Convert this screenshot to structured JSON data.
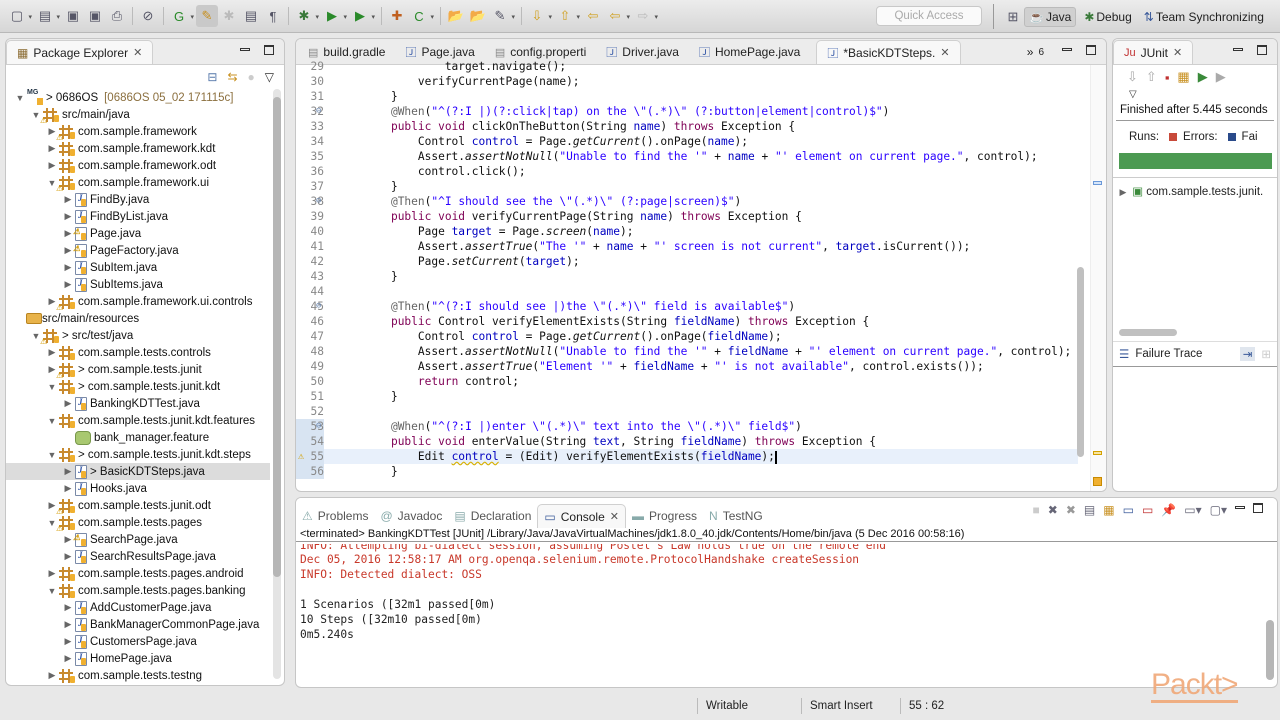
{
  "toolbar": {
    "quick_access_placeholder": "Quick Access",
    "icons": [
      "new-icon",
      "new-menu-icon",
      "save-icon",
      "save-all-icon",
      "print-icon",
      "skip-breakpoints-icon",
      "new-gradle-icon",
      "brush-icon",
      "bug-disabled-icon",
      "toggle-block-icon",
      "show-whitespace-icon",
      "debug-icon",
      "run-icon",
      "run-external-icon",
      "new-package-icon",
      "new-class-icon",
      "open-type-icon",
      "open-folder-icon",
      "search-icon",
      "next-annotation-icon",
      "prev-annotation-icon",
      "last-edit-icon",
      "back-icon",
      "forward-icon"
    ],
    "perspectives": [
      {
        "label": "Java",
        "icon": "java-perspective-icon",
        "active": true
      },
      {
        "label": "Debug",
        "icon": "debug-perspective-icon",
        "active": false
      },
      {
        "label": "Team Synchronizing",
        "icon": "team-sync-icon",
        "active": false
      }
    ]
  },
  "package_explorer": {
    "title": "Package Explorer",
    "tree": [
      {
        "depth": 0,
        "twisty": "open",
        "icon": "proj",
        "label": "> 0686OS",
        "decoration": "[0686OS 05_02 171115c]"
      },
      {
        "depth": 1,
        "twisty": "open",
        "icon": "pkg warn",
        "label": "src/main/java"
      },
      {
        "depth": 2,
        "twisty": "closed",
        "icon": "pkg warn",
        "label": "com.sample.framework"
      },
      {
        "depth": 2,
        "twisty": "closed",
        "icon": "pkg",
        "label": "com.sample.framework.kdt"
      },
      {
        "depth": 2,
        "twisty": "closed",
        "icon": "pkg",
        "label": "com.sample.framework.odt"
      },
      {
        "depth": 2,
        "twisty": "open",
        "icon": "pkg warn",
        "label": "com.sample.framework.ui"
      },
      {
        "depth": 3,
        "twisty": "closed",
        "icon": "jf",
        "label": "FindBy.java"
      },
      {
        "depth": 3,
        "twisty": "closed",
        "icon": "jf",
        "label": "FindByList.java"
      },
      {
        "depth": 3,
        "twisty": "closed",
        "icon": "jf warn",
        "label": "Page.java"
      },
      {
        "depth": 3,
        "twisty": "closed",
        "icon": "jf warn",
        "label": "PageFactory.java"
      },
      {
        "depth": 3,
        "twisty": "closed",
        "icon": "jf",
        "label": "SubItem.java"
      },
      {
        "depth": 3,
        "twisty": "closed",
        "icon": "jf",
        "label": "SubItems.java"
      },
      {
        "depth": 2,
        "twisty": "closed",
        "icon": "pkg warn",
        "label": "com.sample.framework.ui.controls"
      },
      {
        "depth": 1,
        "twisty": "none",
        "icon": "fold",
        "label": "src/main/resources"
      },
      {
        "depth": 1,
        "twisty": "open",
        "icon": "pkg warn",
        "label": "> src/test/java"
      },
      {
        "depth": 2,
        "twisty": "closed",
        "icon": "pkg",
        "label": "com.sample.tests.controls"
      },
      {
        "depth": 2,
        "twisty": "closed",
        "icon": "pkg warn",
        "label": "> com.sample.tests.junit"
      },
      {
        "depth": 2,
        "twisty": "open",
        "icon": "pkg",
        "label": "> com.sample.tests.junit.kdt"
      },
      {
        "depth": 3,
        "twisty": "closed",
        "icon": "jf",
        "label": "BankingKDTTest.java"
      },
      {
        "depth": 2,
        "twisty": "open",
        "icon": "pkg",
        "label": "com.sample.tests.junit.kdt.features"
      },
      {
        "depth": 3,
        "twisty": "none",
        "icon": "feat",
        "label": "bank_manager.feature"
      },
      {
        "depth": 2,
        "twisty": "open",
        "icon": "pkg",
        "label": "> com.sample.tests.junit.kdt.steps"
      },
      {
        "depth": 3,
        "twisty": "closed",
        "icon": "jf",
        "label": "> BasicKDTSteps.java",
        "selected": true
      },
      {
        "depth": 3,
        "twisty": "closed",
        "icon": "jf",
        "label": "Hooks.java"
      },
      {
        "depth": 2,
        "twisty": "closed",
        "icon": "pkg warn",
        "label": "com.sample.tests.junit.odt"
      },
      {
        "depth": 2,
        "twisty": "open",
        "icon": "pkg warn",
        "label": "com.sample.tests.pages"
      },
      {
        "depth": 3,
        "twisty": "closed",
        "icon": "jf warn",
        "label": "SearchPage.java"
      },
      {
        "depth": 3,
        "twisty": "closed",
        "icon": "jf",
        "label": "SearchResultsPage.java"
      },
      {
        "depth": 2,
        "twisty": "closed",
        "icon": "pkg",
        "label": "com.sample.tests.pages.android"
      },
      {
        "depth": 2,
        "twisty": "open",
        "icon": "pkg",
        "label": "com.sample.tests.pages.banking"
      },
      {
        "depth": 3,
        "twisty": "closed",
        "icon": "jf",
        "label": "AddCustomerPage.java"
      },
      {
        "depth": 3,
        "twisty": "closed",
        "icon": "jf",
        "label": "BankManagerCommonPage.java"
      },
      {
        "depth": 3,
        "twisty": "closed",
        "icon": "jf",
        "label": "CustomersPage.java"
      },
      {
        "depth": 3,
        "twisty": "closed",
        "icon": "jf",
        "label": "HomePage.java"
      },
      {
        "depth": 2,
        "twisty": "closed",
        "icon": "pkg",
        "label": "com.sample.tests.testng"
      }
    ]
  },
  "editor": {
    "tabs": [
      {
        "label": "build.gradle",
        "icon": "text-file-icon",
        "active": false
      },
      {
        "label": "Page.java",
        "icon": "java-file-icon",
        "active": false
      },
      {
        "label": "config.properti",
        "icon": "text-file-icon",
        "active": false
      },
      {
        "label": "Driver.java",
        "icon": "java-file-icon",
        "active": false
      },
      {
        "label": "HomePage.java",
        "icon": "java-file-icon",
        "active": false
      },
      {
        "label": "*BasicKDTSteps.",
        "icon": "java-file-icon",
        "active": true
      }
    ],
    "overflow_count": "6",
    "lines": [
      {
        "n": "29",
        "html": "            target.navigate();"
      },
      {
        "n": "30",
        "html": "        verifyCurrentPage(name);"
      },
      {
        "n": "31",
        "html": "    }"
      },
      {
        "n": "32",
        "fold": true,
        "html": "    <span class='an'>@When</span>(<span class='st'>\"^(?:I |)(?:click|tap) on the \\\"(.*)\\\" (?:button|element|control)$\"</span>)"
      },
      {
        "n": "33",
        "html": "    <span class='kw'>public void</span> clickOnTheButton(String <span class='vr'>name</span>) <span class='kw'>throws</span> Exception {"
      },
      {
        "n": "34",
        "html": "        Control <span class='vr'>control</span> = Page.<span class='it'>getCurrent</span>().onPage(<span class='vr'>name</span>);"
      },
      {
        "n": "35",
        "html": "        Assert.<span class='it'>assertNotNull</span>(<span class='st'>\"Unable to find the '\"</span> + <span class='vr'>name</span> + <span class='st'>\"' element on current page.\"</span>, control);"
      },
      {
        "n": "36",
        "html": "        control.click();"
      },
      {
        "n": "37",
        "html": "    }"
      },
      {
        "n": "38",
        "fold": true,
        "html": "    <span class='an'>@Then</span>(<span class='st'>\"^I should see the \\\"(.*)\\\" (?:page|screen)$\"</span>)"
      },
      {
        "n": "39",
        "html": "    <span class='kw'>public void</span> verifyCurrentPage(String <span class='vr'>name</span>) <span class='kw'>throws</span> Exception {"
      },
      {
        "n": "40",
        "html": "        Page <span class='vr'>target</span> = Page.<span class='it'>screen</span>(<span class='vr'>name</span>);"
      },
      {
        "n": "41",
        "html": "        Assert.<span class='it'>assertTrue</span>(<span class='st'>\"The '\"</span> + <span class='vr'>name</span> + <span class='st'>\"' screen is not current\"</span>, <span class='vr'>target</span>.isCurrent());"
      },
      {
        "n": "42",
        "html": "        Page.<span class='it'>setCurrent</span>(<span class='vr'>target</span>);"
      },
      {
        "n": "43",
        "html": "    }"
      },
      {
        "n": "44",
        "html": ""
      },
      {
        "n": "45",
        "fold": true,
        "html": "    <span class='an'>@Then</span>(<span class='st'>\"^(?:I should see |)the \\\"(.*)\\\" field is available$\"</span>)"
      },
      {
        "n": "46",
        "html": "    <span class='kw'>public</span> Control verifyElementExists(String <span class='vr'>fieldName</span>) <span class='kw'>throws</span> Exception {"
      },
      {
        "n": "47",
        "html": "        Control <span class='vr'>control</span> = Page.<span class='it'>getCurrent</span>().onPage(<span class='vr'>fieldName</span>);"
      },
      {
        "n": "48",
        "html": "        Assert.<span class='it'>assertNotNull</span>(<span class='st'>\"Unable to find the '\"</span> + <span class='vr'>fieldName</span> + <span class='st'>\"' element on current page.\"</span>, control);"
      },
      {
        "n": "49",
        "html": "        Assert.<span class='it'>assertTrue</span>(<span class='st'>\"Element '\"</span> + <span class='vr'>fieldName</span> + <span class='st'>\"' is not available\"</span>, control.exists());"
      },
      {
        "n": "50",
        "html": "        <span class='kw'>return</span> control;"
      },
      {
        "n": "51",
        "html": "    }"
      },
      {
        "n": "52",
        "html": ""
      },
      {
        "n": "53",
        "fold": true,
        "mod": true,
        "html": "    <span class='an'>@When</span>(<span class='st'>\"^(?:I |)enter \\\"(.*)\\\" text into the \\\"(.*)\\\" field$\"</span>)"
      },
      {
        "n": "54",
        "mod": true,
        "html": "    <span class='kw'>public void</span> enterValue(String <span class='vr'>text</span>, String <span class='vr'>fieldName</span>) <span class='kw'>throws</span> Exception {"
      },
      {
        "n": "55",
        "mod": true,
        "cur": true,
        "html": "        Edit <span class='vr warnline'>control</span> = (Edit) verifyElementExists(<span class='vr'>fieldName</span>);<span class='caret'></span>"
      },
      {
        "n": "56",
        "mod": true,
        "html": "    }"
      }
    ]
  },
  "junit": {
    "title": "JUnit",
    "finished": "Finished after 5.445 seconds",
    "runs_label": "Runs:",
    "errors_label": "Errors:",
    "failures_label": "Fai",
    "progress": 1.0,
    "progress_color": "#4c9a52",
    "tree_item": "com.sample.tests.junit.",
    "failure_trace": "Failure Trace"
  },
  "console": {
    "tabs": [
      {
        "label": "Problems",
        "icon": "problems-icon",
        "active": false
      },
      {
        "label": "Javadoc",
        "icon": "javadoc-icon",
        "active": false
      },
      {
        "label": "Declaration",
        "icon": "declaration-icon",
        "active": false
      },
      {
        "label": "Console",
        "icon": "console-icon",
        "active": true
      },
      {
        "label": "Progress",
        "icon": "progress-icon",
        "active": false
      },
      {
        "label": "TestNG",
        "icon": "testng-icon",
        "active": false
      }
    ],
    "header": "<terminated> BankingKDTTest [JUnit] /Library/Java/JavaVirtualMachines/jdk1.8.0_40.jdk/Contents/Home/bin/java (5 Dec 2016 00:58:16)",
    "lines": [
      {
        "text": "INFO: Attempting bi-dialect session, assuming Postel's Law holds true on the remote end",
        "red": true,
        "clip": true
      },
      {
        "text": "Dec 05, 2016 12:58:17 AM org.openqa.selenium.remote.ProtocolHandshake createSession",
        "red": true
      },
      {
        "text": "INFO: Detected dialect: OSS",
        "red": true
      },
      {
        "text": "",
        "red": false
      },
      {
        "text": "1 Scenarios ([32m1 passed[0m)",
        "red": false
      },
      {
        "text": "10 Steps ([32m10 passed[0m)",
        "red": false
      },
      {
        "text": "0m5.240s",
        "red": false
      }
    ]
  },
  "status": {
    "writable": "Writable",
    "insert_mode": "Smart Insert",
    "position": "55 : 62"
  },
  "watermark": "Packt>"
}
